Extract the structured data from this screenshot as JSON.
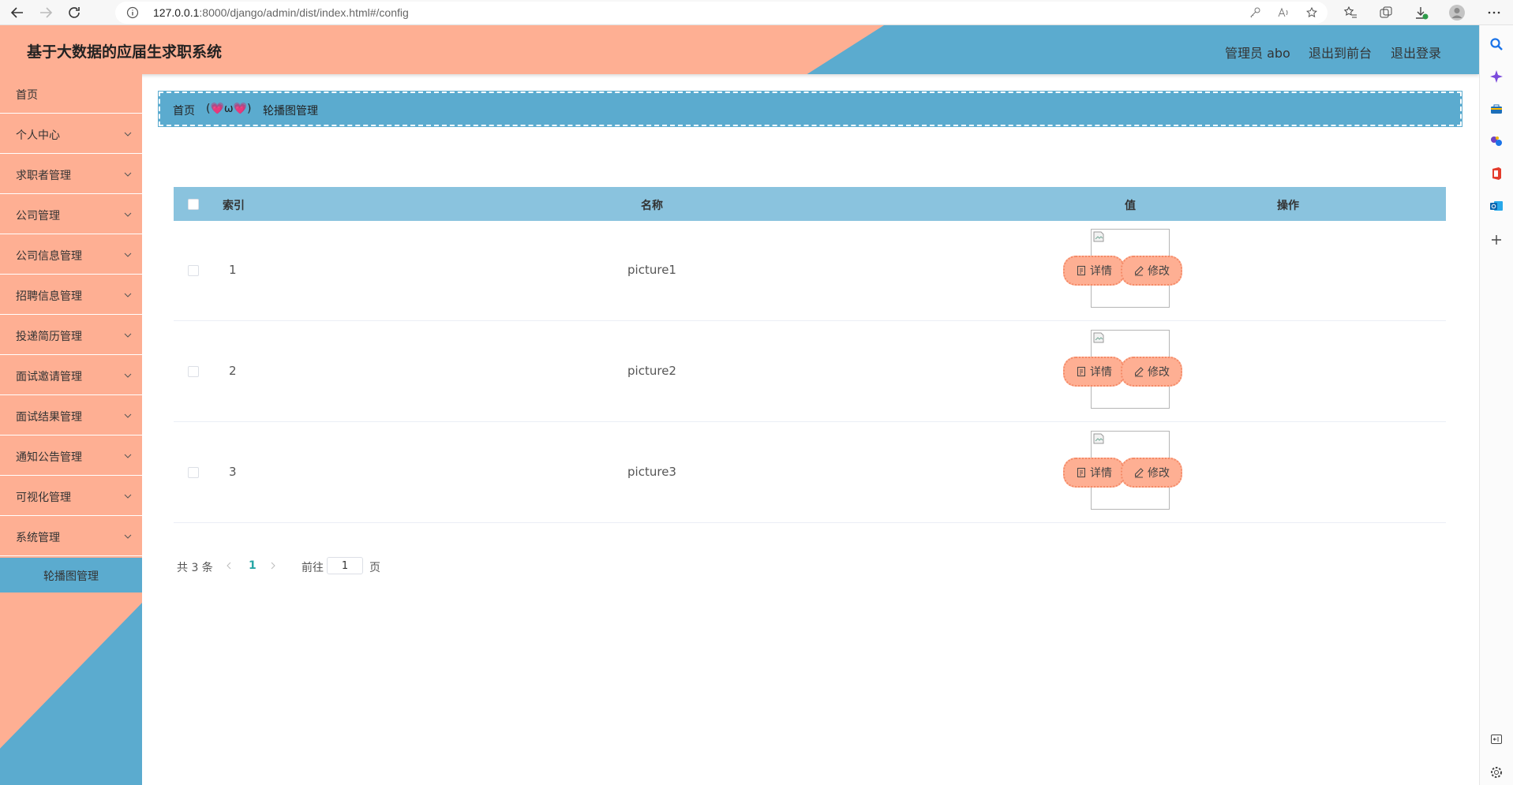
{
  "browser": {
    "url_host": "127.0.0.1",
    "url_rest": ":8000/django/admin/dist/index.html#/config"
  },
  "header": {
    "title": "基于大数据的应届生求职系统",
    "user_label": "管理员 abo",
    "frontend_link": "退出到前台",
    "logout_link": "退出登录"
  },
  "sidebar": {
    "items": [
      {
        "label": "首页",
        "has_arrow": false
      },
      {
        "label": "个人中心",
        "has_arrow": true
      },
      {
        "label": "求职者管理",
        "has_arrow": true
      },
      {
        "label": "公司管理",
        "has_arrow": true
      },
      {
        "label": "公司信息管理",
        "has_arrow": true
      },
      {
        "label": "招聘信息管理",
        "has_arrow": true
      },
      {
        "label": "投递简历管理",
        "has_arrow": true
      },
      {
        "label": "面试邀请管理",
        "has_arrow": true
      },
      {
        "label": "面试结果管理",
        "has_arrow": true
      },
      {
        "label": "通知公告管理",
        "has_arrow": true
      },
      {
        "label": "可视化管理",
        "has_arrow": true
      },
      {
        "label": "系统管理",
        "has_arrow": true
      }
    ],
    "submenu_active": "轮播图管理"
  },
  "breadcrumb": {
    "home": "首页",
    "separator": "(💗ω💗)",
    "current": "轮播图管理"
  },
  "table": {
    "columns": {
      "index": "索引",
      "name": "名称",
      "value": "值",
      "actions": "操作"
    },
    "rows": [
      {
        "index": "1",
        "name": "picture1"
      },
      {
        "index": "2",
        "name": "picture2"
      },
      {
        "index": "3",
        "name": "picture3"
      }
    ],
    "detail_label": "详情",
    "edit_label": "修改"
  },
  "pagination": {
    "total": "共 3 条",
    "current_page": "1",
    "goto_label": "前往",
    "goto_value": "1",
    "page_suffix": "页"
  },
  "colors": {
    "peach": "#feaf93",
    "blue": "#5babcf",
    "table_header": "#8ac3de",
    "active_page": "#27a6a5"
  }
}
